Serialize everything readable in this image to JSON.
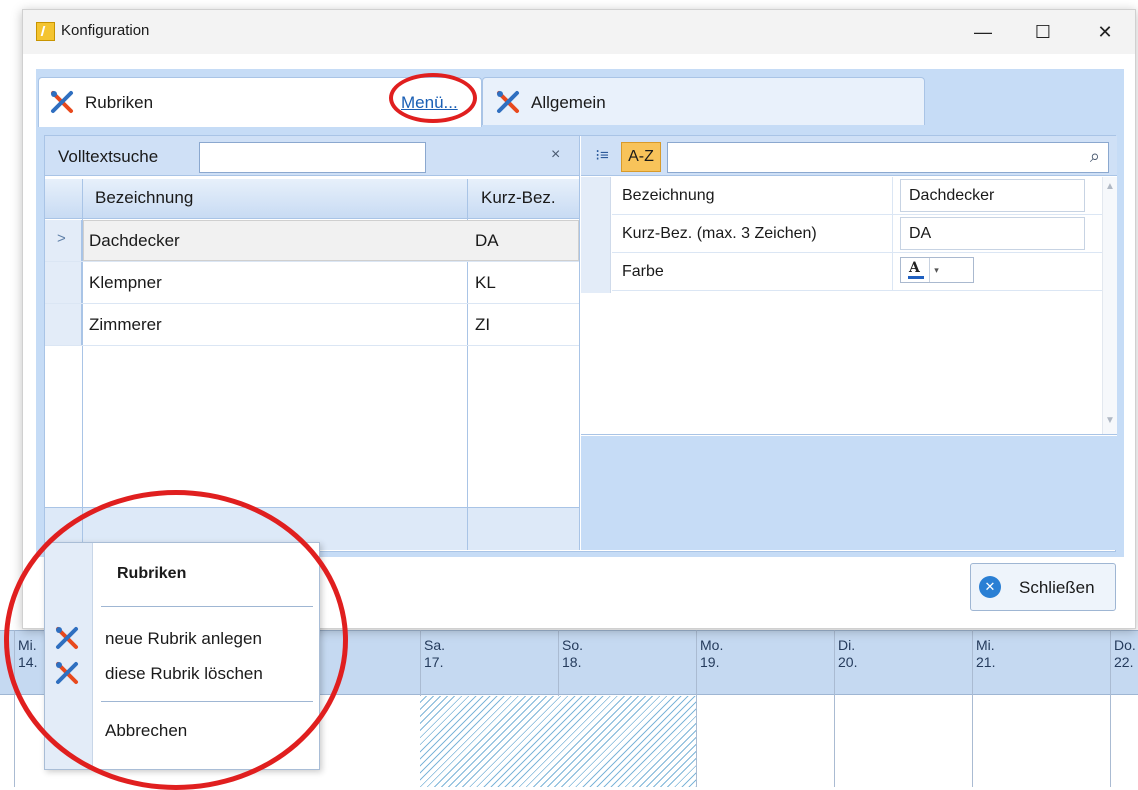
{
  "window": {
    "title": "Konfiguration",
    "minimize": "—",
    "maximize": "☐",
    "close": "✕"
  },
  "tabs": [
    {
      "label": "Rubriken",
      "menu_link": "Menü..."
    },
    {
      "label": "Allgemein"
    }
  ],
  "search": {
    "label": "Volltextsuche",
    "value": "",
    "clear": "×"
  },
  "grid": {
    "columns": [
      "Bezeichnung",
      "Kurz-Bez."
    ],
    "rows": [
      {
        "name": "Dachdecker",
        "short": "DA",
        "selected": true
      },
      {
        "name": "Klempner",
        "short": "KL"
      },
      {
        "name": "Zimmerer",
        "short": "ZI"
      }
    ],
    "selected_arrow": ">"
  },
  "property_grid": {
    "toolbar": {
      "categorized": "⁝≡",
      "alphabetical": "A-Z",
      "search_value": "",
      "search_icon": "⌕"
    },
    "rows": [
      {
        "name": "Bezeichnung",
        "value": "Dachdecker"
      },
      {
        "name": "Kurz-Bez. (max. 3 Zeichen)",
        "value": "DA"
      },
      {
        "name": "Farbe",
        "value_icon": "A"
      }
    ]
  },
  "close_button": {
    "label": "Schließen",
    "icon": "close-circle-icon"
  },
  "popup_menu": {
    "title": "Rubriken",
    "items": [
      {
        "label": "neue Rubrik anlegen",
        "icon": "tools-icon"
      },
      {
        "label": "diese Rubrik löschen",
        "icon": "tools-icon"
      },
      {
        "label": "Abbrechen"
      }
    ]
  },
  "calendar": {
    "days": [
      {
        "label": "Mi.\n14."
      },
      {
        "label": "Sa.\n17."
      },
      {
        "label": "So.\n18."
      },
      {
        "label": "Mo.\n19."
      },
      {
        "label": "Di.\n20."
      },
      {
        "label": "Mi.\n21."
      },
      {
        "label": "Do.\n22."
      }
    ]
  },
  "colors": {
    "accent_blue": "#c6dcf6",
    "annotation_red": "#e01f1f",
    "az_button": "#f8c35a"
  }
}
